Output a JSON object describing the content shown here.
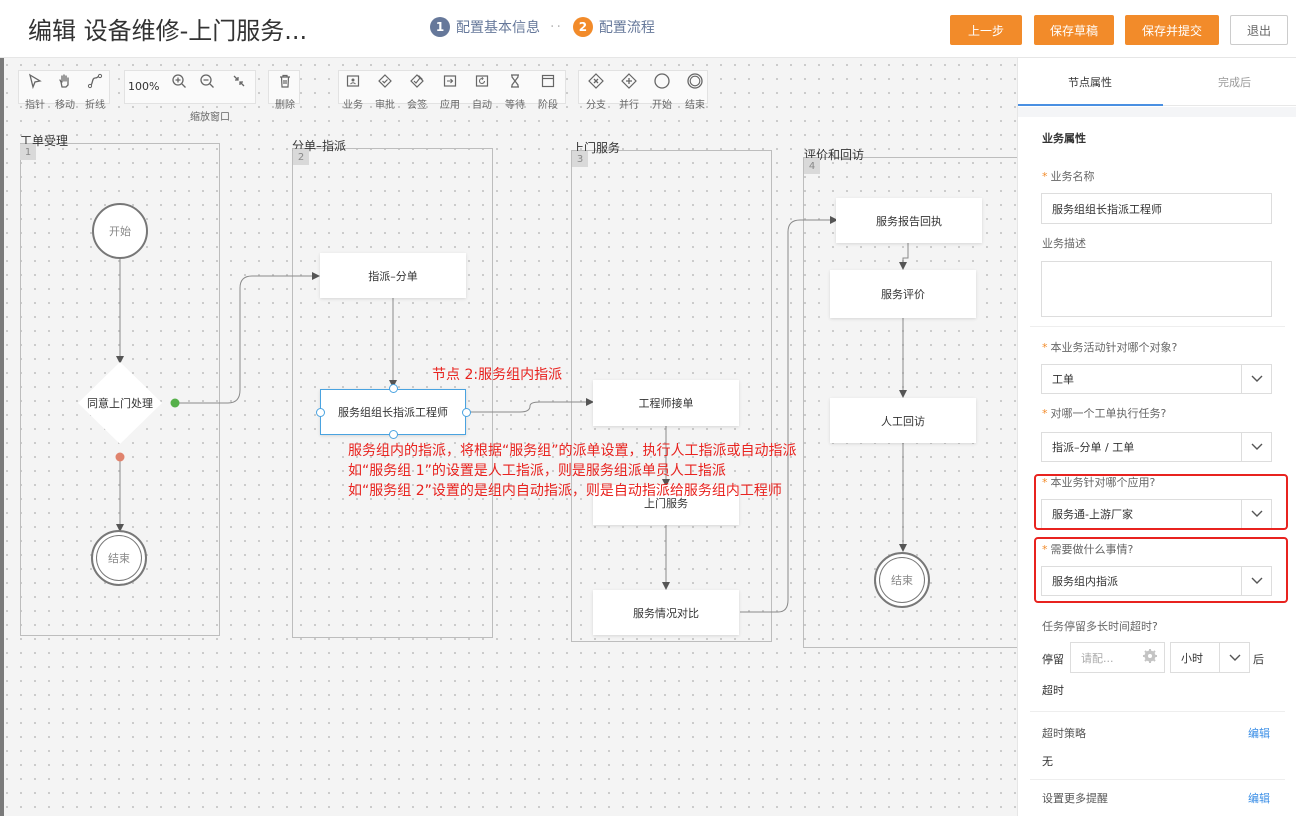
{
  "header": {
    "title": "编辑 设备维修-上门服务...",
    "steps": [
      {
        "num": "1",
        "label": "配置基本信息"
      },
      {
        "num": "2",
        "label": "配置流程"
      }
    ],
    "step_separator": "··",
    "buttons": {
      "prev": "上一步",
      "save_draft": "保存草稿",
      "save_submit": "保存并提交",
      "exit": "退出"
    }
  },
  "toolbar": {
    "pointer": "指针",
    "move": "移动",
    "polyline": "折线",
    "zoom_value": "100%",
    "zoom_label": "缩放窗口",
    "delete": "删除",
    "business": "业务",
    "approve": "审批",
    "countersign": "会签",
    "app": "应用",
    "auto": "自动",
    "wait": "等待",
    "stage": "阶段",
    "branch": "分支",
    "parallel": "并行",
    "start": "开始",
    "end": "结束"
  },
  "lanes": [
    {
      "num": "1",
      "title": "工单受理"
    },
    {
      "num": "2",
      "title": "分单–指派"
    },
    {
      "num": "3",
      "title": "上门服务"
    },
    {
      "num": "4",
      "title": "评价和回访"
    }
  ],
  "nodes": {
    "start": "开始",
    "decision": "同意上门处理",
    "end1": "结束",
    "assign_split": "指派–分单",
    "group_leader": "服务组组长指派工程师",
    "engineer_accept": "工程师接单",
    "onsite": "上门服务",
    "compare": "服务情况对比",
    "report": "服务报告回执",
    "evaluate": "服务评价",
    "revisit": "人工回访",
    "end4": "结束"
  },
  "annotations": {
    "node_title": "节点 2:服务组内指派",
    "line1": "服务组内的指派，将根据“服务组”的派单设置，执行人工指派或自动指派",
    "line2": "如“服务组 1”的设置是人工指派，则是服务组派单员人工指派",
    "line3": "如“服务组 2”设置的是组内自动指派，则是自动指派给服务组内工程师"
  },
  "panel": {
    "tabs": {
      "props": "节点属性",
      "after": "完成后"
    },
    "section_title": "业务属性",
    "name_label": "业务名称",
    "name_value": "服务组组长指派工程师",
    "desc_label": "业务描述",
    "object_label": "本业务活动针对哪个对象?",
    "object_value": "工单",
    "task_label": "对哪一个工单执行任务?",
    "task_value": "指派–分单 / 工单",
    "app_label": "本业务针对哪个应用?",
    "app_value": "服务通-上游厂家",
    "todo_label": "需要做什么事情?",
    "todo_value": "服务组内指派",
    "timeout_q": "任务停留多长时间超时?",
    "stay_label": "停留",
    "stay_placeholder": "请配...",
    "unit_value": "小时",
    "after_label": "后",
    "timeout_label": "超时",
    "strategy_label": "超时策略",
    "strategy_edit": "编辑",
    "strategy_value": "无",
    "reminder_label": "设置更多提醒",
    "reminder_edit": "编辑"
  },
  "colors": {
    "accent_orange": "#f28b2a",
    "annotation_red": "#e8231f",
    "link_blue": "#3a8ee6",
    "selection_blue": "#4aa3e0"
  }
}
